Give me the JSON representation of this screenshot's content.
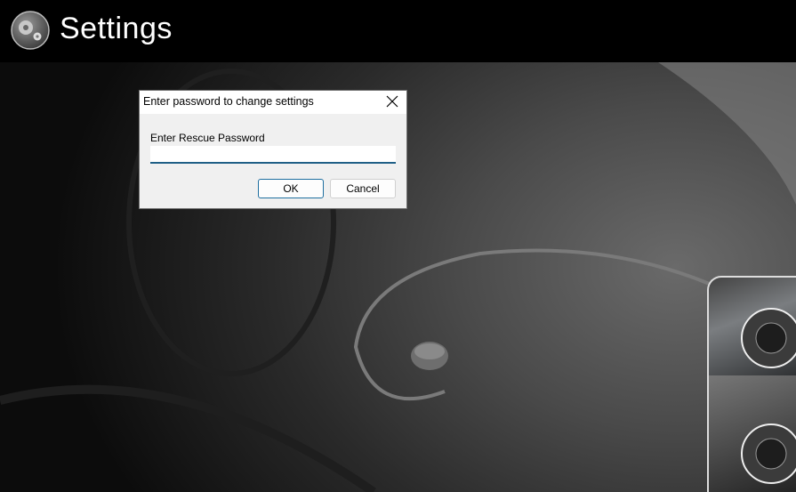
{
  "header": {
    "title": "Settings",
    "logo_icon": "settings-gears-icon"
  },
  "dialog": {
    "title": "Enter password to change settings",
    "close_icon": "close-icon",
    "field_label": "Enter Rescue Password",
    "password_value": "",
    "ok_label": "OK",
    "cancel_label": "Cancel"
  },
  "colors": {
    "accent": "#1f5f86",
    "header_bg": "#000000",
    "dialog_bg": "#f0f0f0"
  }
}
